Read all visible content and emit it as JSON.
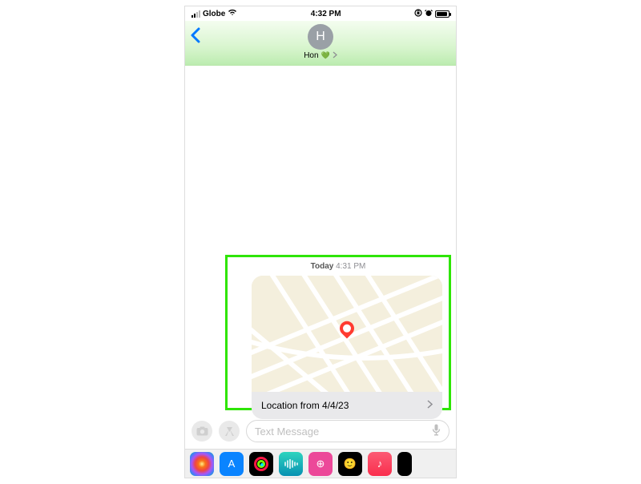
{
  "statusbar": {
    "carrier": "Globe",
    "time": "4:32 PM"
  },
  "header": {
    "avatar_initial": "H",
    "contact_name": "Hon",
    "heart_emoji": "💚"
  },
  "conversation": {
    "timestamp_day": "Today",
    "timestamp_time": "4:31 PM",
    "location_label": "Location from 4/4/23"
  },
  "compose": {
    "placeholder": "Text Message"
  },
  "dock": {
    "appstore_glyph": "A",
    "music_note": "♪",
    "globe": "⊕",
    "memoji": "🙂"
  }
}
